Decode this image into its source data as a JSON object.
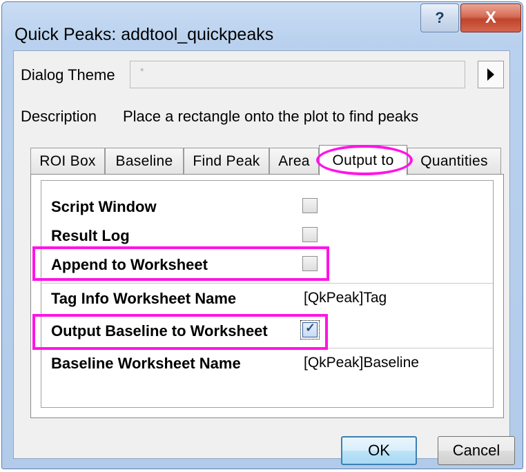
{
  "window": {
    "title": "Quick Peaks: addtool_quickpeaks",
    "help_symbol": "?",
    "close_symbol": "X"
  },
  "theme": {
    "label": "Dialog Theme",
    "value": "*"
  },
  "description": {
    "label": "Description",
    "text": "Place a rectangle onto the plot to find peaks"
  },
  "tabs": [
    {
      "label": "ROI Box"
    },
    {
      "label": "Baseline"
    },
    {
      "label": "Find Peak"
    },
    {
      "label": "Area"
    },
    {
      "label": "Output to",
      "active": true
    },
    {
      "label": "Quantities"
    }
  ],
  "output": {
    "script_window": {
      "label": "Script Window",
      "checked": false
    },
    "result_log": {
      "label": "Result Log",
      "checked": false
    },
    "append_to_worksheet": {
      "label": "Append to Worksheet",
      "checked": false
    },
    "tag_info_name": {
      "label": "Tag Info Worksheet Name",
      "value": "[QkPeak]Tag"
    },
    "output_baseline": {
      "label": "Output Baseline to Worksheet",
      "checked": true,
      "mark": "✓"
    },
    "baseline_name": {
      "label": "Baseline Worksheet Name",
      "value": "[QkPeak]Baseline"
    }
  },
  "buttons": {
    "ok": "OK",
    "cancel": "Cancel"
  },
  "highlight_color": "#ff14e6"
}
